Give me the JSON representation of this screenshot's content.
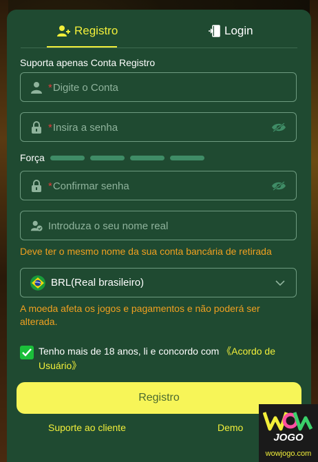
{
  "tabs": {
    "register_label": "Registro",
    "login_label": "Login"
  },
  "form": {
    "support_note": "Suporta apenas Conta Registro",
    "account_placeholder": "Digite o Conta",
    "password_placeholder": "Insira a senha",
    "strength_label": "Força",
    "confirm_placeholder": "Confirmar senha",
    "realname_placeholder": "Introduza o seu nome real",
    "realname_hint": "Deve ter o mesmo nome da sua conta bancária de retirada",
    "currency_value": "BRL(Real brasileiro)",
    "currency_hint": "A moeda afeta os jogos e pagamentos e não poderá ser alterada.",
    "required_mark": "*",
    "agree_text": "Tenho mais de 18 anos, li e concordo com ",
    "agree_link": "《Acordo de Usuário》",
    "agree_checked": true,
    "submit_label": "Registro"
  },
  "footer": {
    "support_label": "Suporte ao cliente",
    "demo_label": "Demo"
  },
  "logo": {
    "brand": "WOW",
    "jogo": "JOGO",
    "url": "wowjogo.com"
  },
  "colors": {
    "panel": "#1f4a31",
    "accent_yellow": "#f2ef3a",
    "button_yellow": "#f7f558",
    "hint_orange": "#f0a020",
    "checkbox_green": "#1bbf3a",
    "strength_bar": "#3f8c66"
  },
  "icons": {
    "register_tab": "user-plus-icon",
    "login_tab": "door-enter-icon",
    "account_field": "user-icon",
    "password_field": "lock-icon",
    "password_visibility": "eye-off-icon",
    "realname_field": "user-check-icon",
    "currency_flag": "brazil-flag-icon",
    "currency_dropdown": "chevron-down-icon",
    "agree_checkbox": "checkmark-icon"
  }
}
